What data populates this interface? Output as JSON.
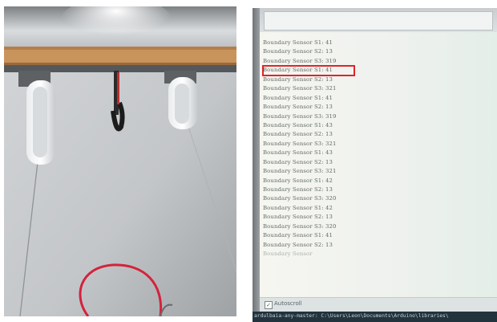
{
  "serial_monitor": {
    "lines": [
      "Boundary Sensor S1: 41",
      "Boundary Sensor S2: 13",
      "Boundary Sensor S3: 319",
      "Boundary Sensor S1: 41",
      "Boundary Sensor S2: 13",
      "Boundary Sensor S3: 321",
      "Boundary Sensor S1: 41",
      "Boundary Sensor S2: 13",
      "Boundary Sensor S3: 319",
      "Boundary Sensor S1: 43",
      "Boundary Sensor S2: 13",
      "Boundary Sensor S3: 321",
      "Boundary Sensor S1: 43",
      "Boundary Sensor S2: 13",
      "Boundary Sensor S3: 321",
      "Boundary Sensor S1: 42",
      "Boundary Sensor S2: 13",
      "Boundary Sensor S3: 320",
      "Boundary Sensor S1: 42",
      "Boundary Sensor S2: 13",
      "Boundary Sensor S3: 320",
      "Boundary Sensor S1: 41",
      "Boundary Sensor S2: 13",
      "Boundary Sensor"
    ],
    "highlighted_line_index": 1,
    "highlight_color": "#e0242b",
    "autoscroll_label": "Autoscroll",
    "autoscroll_checked": true
  },
  "status_bar": {
    "text": "ardulbaia-any-master: C:\\Users\\Leon\\Documents\\Arduino\\libraries\\"
  }
}
